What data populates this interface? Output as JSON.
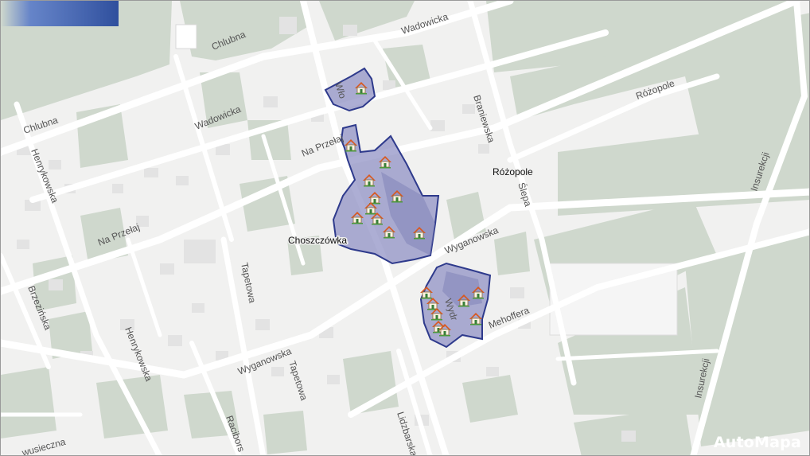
{
  "map": {
    "colors": {
      "background": "#f1f1f0",
      "green": "#cfd8cd",
      "road": "#ffffff",
      "block": "#e2e2e2",
      "area_fill": "#8e8fc3",
      "area_stroke": "#2e3a8c"
    },
    "streets": {
      "chlubna_1": "Chlubna",
      "chlubna_2": "Chlubna",
      "wadowicka_1": "Wadowicka",
      "wadowicka_2": "Wadowicka",
      "na_przelaj_1": "Na Przełaj",
      "na_przelaj_2": "Na Przełaj",
      "henrykowska_1": "Henrykowska",
      "henrykowska_2": "Henrykowska",
      "brzezinska": "Brzezińska",
      "tapetowa_1": "Tapetowa",
      "tapetowa_2": "Tapetowa",
      "wyganowska_1": "Wyganowska",
      "wyganowska_2": "Wyganowska",
      "braniewska": "Braniewska",
      "rozopole_street": "Różopole",
      "slepa": "Ślepa",
      "insurekcji_1": "Insurekcji",
      "insurekcji_2": "Insurekcji",
      "mehoffera": "Mehoffera",
      "lidzbarska": "Lidzbarska",
      "raciborska": "Racibors",
      "wloska": "Wło",
      "wydra": "Wydr",
      "dwusieczna": "wusieczna"
    },
    "places": {
      "rozopole": "Różopole",
      "choszczowka": "Choszczówka"
    },
    "icon": "house-icon",
    "brand": "AutoMapa"
  }
}
